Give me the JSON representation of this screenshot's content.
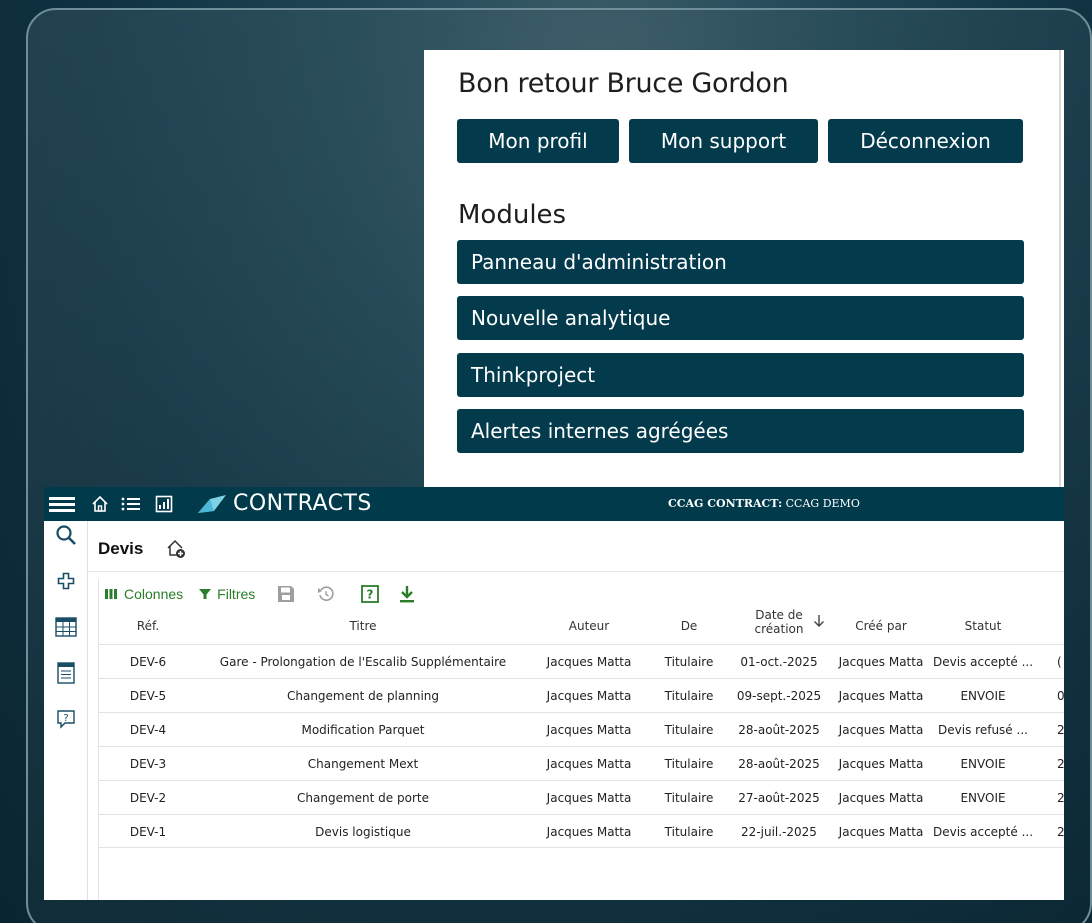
{
  "welcome": {
    "greeting": "Bon retour Bruce Gordon",
    "buttons": [
      "Mon profil",
      "Mon support",
      "Déconnexion"
    ],
    "modules_title": "Modules",
    "modules": [
      "Panneau d'administration",
      "Nouvelle analytique",
      "Thinkproject",
      "Alertes internes agrégées"
    ]
  },
  "topbar": {
    "brand": "CONTRACTS",
    "contract_label": "CCAG CONTRACT:",
    "contract_value": "CCAG DEMO"
  },
  "page": {
    "title": "Devis"
  },
  "toolbar": {
    "columns": "Colonnes",
    "filters": "Filtres"
  },
  "table": {
    "headers": {
      "ref": "Réf.",
      "titre": "Titre",
      "auteur": "Auteur",
      "de": "De",
      "date_line1": "Date de",
      "date_line2": "création",
      "cree_par": "Créé par",
      "statut": "Statut"
    },
    "rows": [
      {
        "ref": "DEV-6",
        "titre": "Gare - Prolongation de l'Escalib Supplémentaire",
        "auteur": "Jacques Matta",
        "de": "Titulaire",
        "date": "01-oct.-2025",
        "cree_par": "Jacques Matta",
        "statut": "Devis accepté ...",
        "extra": "("
      },
      {
        "ref": "DEV-5",
        "titre": "Changement de planning",
        "auteur": "Jacques Matta",
        "de": "Titulaire",
        "date": "09-sept.-2025",
        "cree_par": "Jacques Matta",
        "statut": "ENVOIE",
        "extra": "0"
      },
      {
        "ref": "DEV-4",
        "titre": "Modification Parquet",
        "auteur": "Jacques Matta",
        "de": "Titulaire",
        "date": "28-août-2025",
        "cree_par": "Jacques Matta",
        "statut": "Devis refusé ...",
        "extra": "2"
      },
      {
        "ref": "DEV-3",
        "titre": "Changement Mext",
        "auteur": "Jacques Matta",
        "de": "Titulaire",
        "date": "28-août-2025",
        "cree_par": "Jacques Matta",
        "statut": "ENVOIE",
        "extra": "2"
      },
      {
        "ref": "DEV-2",
        "titre": "Changement de porte",
        "auteur": "Jacques Matta",
        "de": "Titulaire",
        "date": "27-août-2025",
        "cree_par": "Jacques Matta",
        "statut": "ENVOIE",
        "extra": "2"
      },
      {
        "ref": "DEV-1",
        "titre": "Devis logistique",
        "auteur": "Jacques Matta",
        "de": "Titulaire",
        "date": "22-juil.-2025",
        "cree_par": "Jacques Matta",
        "statut": "Devis accepté ...",
        "extra": "2"
      }
    ]
  },
  "colors": {
    "button_bg": "#033b4c",
    "topbar_bg": "#013a4b",
    "toolbar_green": "#2a7d2a"
  },
  "icons": {
    "topbar": [
      "hamburger-icon",
      "home-icon",
      "list-icon",
      "report-icon",
      "brand-logo-icon"
    ],
    "sidebar": [
      "search-icon",
      "add-icon",
      "table-icon",
      "document-icon",
      "help-chat-icon"
    ],
    "toolbar": [
      "columns-icon",
      "filter-icon",
      "save-icon",
      "reset-icon",
      "help-icon",
      "download-icon",
      "sort-down-icon"
    ]
  }
}
